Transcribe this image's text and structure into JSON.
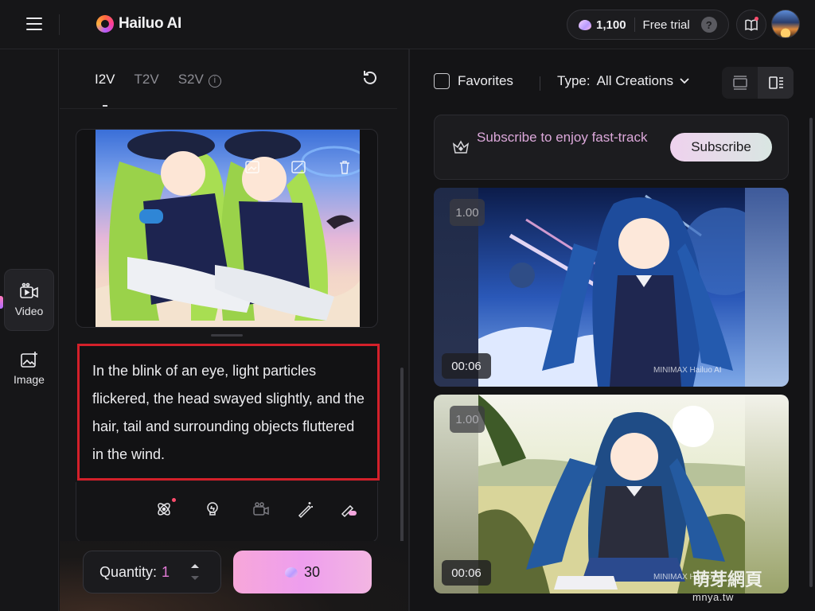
{
  "topbar": {
    "brand": "Hailuo AI",
    "credits": "1,100",
    "free_trial_label": "Free trial",
    "help_glyph": "?"
  },
  "rail": {
    "items": [
      {
        "label": "Video",
        "icon": "video-icon",
        "active": true
      },
      {
        "label": "Image",
        "icon": "image-icon",
        "active": false
      }
    ]
  },
  "panel": {
    "tabs": [
      {
        "label": "I2V",
        "active": true
      },
      {
        "label": "T2V",
        "active": false
      },
      {
        "label": "S2V",
        "active": false
      }
    ],
    "info_glyph": "i",
    "prompt_text": "In the blink of an eye, light particles flickered, the head swayed slightly, and the hair, tail and surrounding objects fluttered in the wind.",
    "quantity_label": "Quantity:",
    "quantity_value": "1",
    "generate_cost": "30"
  },
  "feed": {
    "favorites_label": "Favorites",
    "type_label": "Type:",
    "type_value": "All Creations",
    "subscribe_text": "Subscribe to enjoy fast-track",
    "subscribe_button": "Subscribe",
    "videos": [
      {
        "ratio": "1.00",
        "duration": "00:06",
        "watermark": "MINIMAX  Hailuo AI"
      },
      {
        "ratio": "1.00",
        "duration": "00:06",
        "watermark": "MINIMAX  Hailuo AI"
      }
    ]
  },
  "site_watermark": {
    "name": "萌芽網頁",
    "url": "mnya.tw"
  },
  "colors": {
    "accent_pink": "#f3a6dd",
    "highlight_red": "#d3202a",
    "quantity_value": "#e37bd6"
  }
}
